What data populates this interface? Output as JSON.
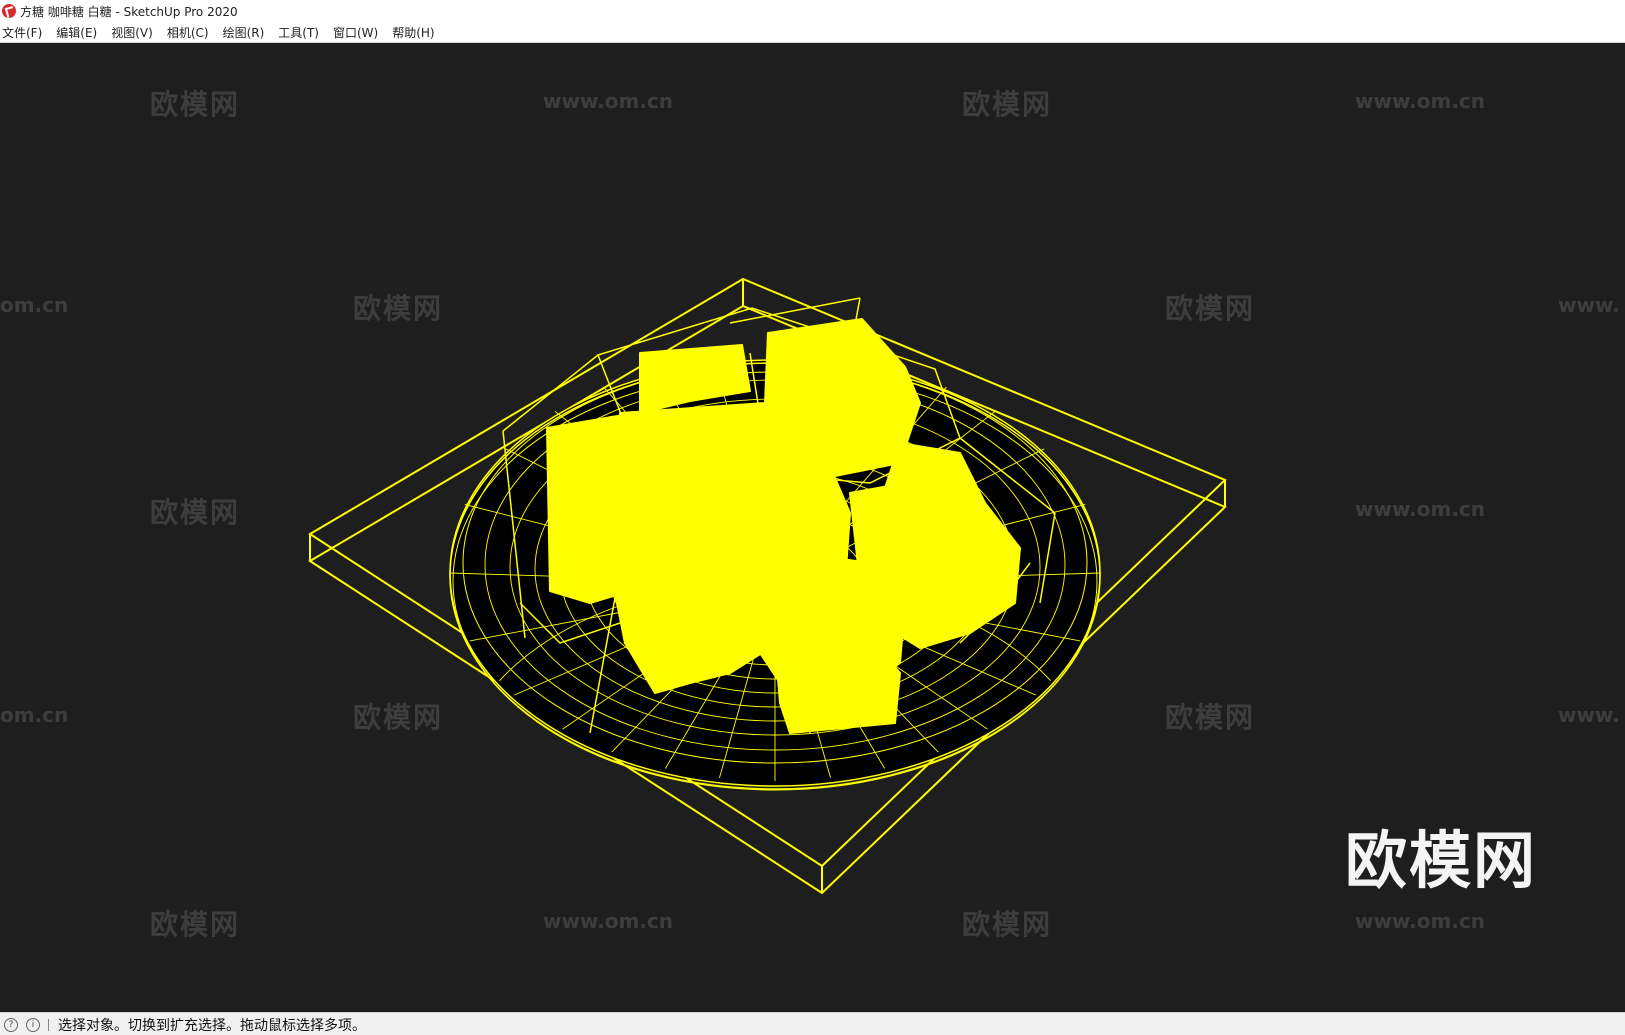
{
  "window": {
    "title": "方糖 咖啡糖 白糖 - SketchUp Pro 2020"
  },
  "menu": [
    {
      "label": "文件(F)"
    },
    {
      "label": "编辑(E)"
    },
    {
      "label": "视图(V)"
    },
    {
      "label": "相机(C)"
    },
    {
      "label": "绘图(R)"
    },
    {
      "label": "工具(T)"
    },
    {
      "label": "窗口(W)"
    },
    {
      "label": "帮助(H)"
    }
  ],
  "watermarks": {
    "cn": "欧模网",
    "url": "www.om.cn",
    "url_partial": "om.cn",
    "url_partial_right": "www."
  },
  "logo": {
    "text": "欧模网"
  },
  "status": {
    "message": "选择对象。切换到扩充选择。拖动鼠标选择多项。",
    "icon1": "?",
    "icon2": "i"
  },
  "colors": {
    "selection": "#ffff00",
    "viewport_background": "#1e1e1e"
  }
}
